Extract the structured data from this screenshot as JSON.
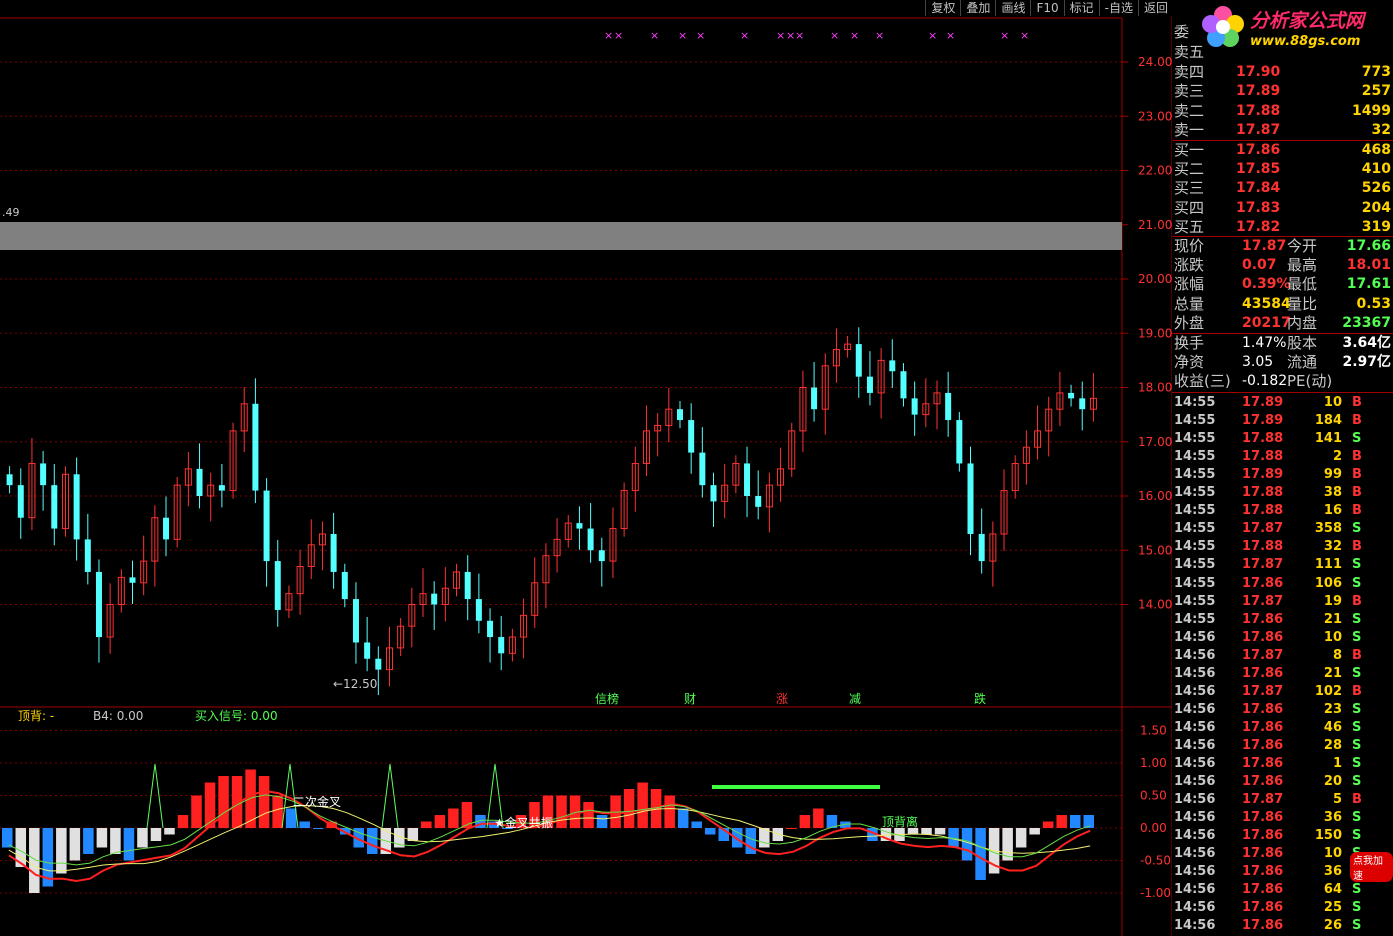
{
  "toolbar": [
    "复权",
    "叠加",
    "画线",
    "F10",
    "标记",
    "-自选",
    "返回"
  ],
  "logo": {
    "brand": "分析家公式网",
    "url": "www.88gs.com"
  },
  "colors": {
    "up": "#ff3232",
    "down": "#54ffff",
    "grid": "#7a0000",
    "axis": "#a00000",
    "label_red": "#ff3232",
    "label_yellow": "#ffd400",
    "label_green": "#52ff52",
    "magenta": "#ff40ff"
  },
  "price_axis": {
    "ticks": [
      "24.00",
      "23.00",
      "22.00",
      "21.00",
      "20.00",
      "19.00",
      "18.00",
      "17.00",
      "16.00",
      "15.00",
      "14.00"
    ],
    "min": 12.6,
    "max": 24.0
  },
  "price_chart": {
    "left_level_label": "49",
    "min_marker": "←12.50",
    "bottom_tags": [
      {
        "text": "信榜",
        "color": "#52ff52",
        "x": 607
      },
      {
        "text": "财",
        "color": "#52ff52",
        "x": 690
      },
      {
        "text": "涨",
        "color": "#ff3232",
        "x": 782
      },
      {
        "text": "减",
        "color": "#52ff52",
        "x": 855
      },
      {
        "text": "跌",
        "color": "#52ff52",
        "x": 980
      }
    ],
    "top_marker": "×"
  },
  "indicator": {
    "legend": [
      {
        "text": "顶背: -",
        "color": "#ffd400"
      },
      {
        "text": "B4: 0.00",
        "color": "#c8c8c8"
      },
      {
        "text": "买入信号: 0.00",
        "color": "#52ff52"
      }
    ],
    "axis_ticks": [
      "1.50",
      "1.00",
      "0.50",
      "0.00",
      "-0.50",
      "-1.00"
    ],
    "annotations": [
      {
        "text": "二次金叉",
        "color": "#ffffff"
      },
      {
        "text": "★金叉共振",
        "color": "#ffffff"
      },
      {
        "text": "顶背离",
        "color": "#52ff52"
      }
    ]
  },
  "chart_data": {
    "type": "candlestick",
    "price": {
      "ylim": [
        12.6,
        24.0
      ],
      "approx_closes": [
        16.2,
        15.6,
        16.6,
        16.2,
        15.4,
        16.4,
        15.2,
        14.6,
        13.4,
        14.0,
        14.5,
        14.4,
        14.8,
        15.6,
        15.2,
        16.2,
        16.5,
        16.0,
        16.2,
        16.1,
        17.2,
        17.7,
        16.1,
        14.8,
        13.9,
        14.2,
        14.7,
        15.1,
        15.3,
        14.6,
        14.1,
        13.3,
        13.0,
        12.8,
        13.2,
        13.6,
        14.0,
        14.2,
        14.0,
        14.3,
        14.6,
        14.1,
        13.7,
        13.4,
        13.1,
        13.4,
        13.8,
        14.4,
        14.9,
        15.2,
        15.5,
        15.4,
        15.0,
        14.8,
        15.4,
        16.1,
        16.6,
        17.2,
        17.3,
        17.6,
        17.4,
        16.8,
        16.2,
        15.9,
        16.2,
        16.6,
        16.0,
        15.8,
        16.2,
        16.5,
        17.2,
        18.0,
        17.6,
        18.4,
        18.7,
        18.8,
        18.2,
        17.9,
        18.5,
        18.3,
        17.8,
        17.5,
        17.7,
        17.9,
        17.4,
        16.6,
        15.3,
        14.8,
        15.3,
        16.1,
        16.6,
        16.9,
        17.2,
        17.6,
        17.9,
        17.8,
        17.6,
        17.8
      ]
    },
    "indicator": {
      "ylim": [
        -1.2,
        1.7
      ],
      "hist_approx": [
        -0.3,
        -0.6,
        -1.0,
        -0.9,
        -0.7,
        -0.5,
        -0.4,
        -0.3,
        -0.4,
        -0.5,
        -0.3,
        -0.2,
        -0.1,
        0.2,
        0.5,
        0.7,
        0.8,
        0.8,
        0.9,
        0.8,
        0.5,
        0.3,
        0.1,
        0.0,
        0.1,
        -0.1,
        -0.3,
        -0.4,
        -0.4,
        -0.3,
        -0.2,
        0.1,
        0.2,
        0.3,
        0.4,
        0.2,
        0.1,
        0.0,
        0.2,
        0.4,
        0.5,
        0.5,
        0.5,
        0.4,
        0.2,
        0.5,
        0.6,
        0.7,
        0.6,
        0.5,
        0.3,
        0.1,
        -0.1,
        -0.2,
        -0.3,
        -0.4,
        -0.3,
        -0.2,
        0.0,
        0.2,
        0.3,
        0.2,
        0.1,
        0.0,
        -0.2,
        -0.2,
        -0.2,
        -0.1,
        -0.1,
        -0.1,
        -0.3,
        -0.5,
        -0.8,
        -0.7,
        -0.5,
        -0.3,
        -0.1,
        0.1,
        0.2,
        0.2,
        0.2
      ]
    }
  },
  "quote": {
    "header_label": "委",
    "asks": [
      {
        "label": "卖五",
        "price": "",
        "vol": ""
      },
      {
        "label": "卖四",
        "price": "17.90",
        "vol": "773"
      },
      {
        "label": "卖三",
        "price": "17.89",
        "vol": "257"
      },
      {
        "label": "卖二",
        "price": "17.88",
        "vol": "1499"
      },
      {
        "label": "卖一",
        "price": "17.87",
        "vol": "32"
      }
    ],
    "bids": [
      {
        "label": "买一",
        "price": "17.86",
        "vol": "468"
      },
      {
        "label": "买二",
        "price": "17.85",
        "vol": "410"
      },
      {
        "label": "买三",
        "price": "17.84",
        "vol": "526"
      },
      {
        "label": "买四",
        "price": "17.83",
        "vol": "204"
      },
      {
        "label": "买五",
        "price": "17.82",
        "vol": "319"
      }
    ],
    "stats": [
      {
        "l1": "现价",
        "v1": "17.87",
        "c1": "#ff3232",
        "l2": "今开",
        "v2": "17.66",
        "c2": "#52ff52"
      },
      {
        "l1": "涨跌",
        "v1": "0.07",
        "c1": "#ff3232",
        "l2": "最高",
        "v2": "18.01",
        "c2": "#ff3232"
      },
      {
        "l1": "涨幅",
        "v1": "0.39%",
        "c1": "#ff3232",
        "l2": "最低",
        "v2": "17.61",
        "c2": "#52ff52"
      },
      {
        "l1": "总量",
        "v1": "43584",
        "c1": "#ffd400",
        "l2": "量比",
        "v2": "0.53",
        "c2": "#ffd400"
      },
      {
        "l1": "外盘",
        "v1": "20217",
        "c1": "#ff3232",
        "l2": "内盘",
        "v2": "23367",
        "c2": "#52ff52"
      }
    ],
    "fin": [
      {
        "l1": "换手",
        "v1": "1.47%",
        "l2": "股本",
        "v2": "3.64亿"
      },
      {
        "l1": "净资",
        "v1": "3.05",
        "l2": "流通",
        "v2": "2.97亿"
      },
      {
        "l1": "收益(三)",
        "v1": "-0.182",
        "l2": "PE(动)",
        "v2": ""
      }
    ]
  },
  "trades": [
    {
      "t": "14:55",
      "p": "17.89",
      "q": "10",
      "d": "B"
    },
    {
      "t": "14:55",
      "p": "17.89",
      "q": "184",
      "d": "B"
    },
    {
      "t": "14:55",
      "p": "17.88",
      "q": "141",
      "d": "S"
    },
    {
      "t": "14:55",
      "p": "17.88",
      "q": "2",
      "d": "B"
    },
    {
      "t": "14:55",
      "p": "17.89",
      "q": "99",
      "d": "B"
    },
    {
      "t": "14:55",
      "p": "17.88",
      "q": "38",
      "d": "B"
    },
    {
      "t": "14:55",
      "p": "17.88",
      "q": "16",
      "d": "B"
    },
    {
      "t": "14:55",
      "p": "17.87",
      "q": "358",
      "d": "S"
    },
    {
      "t": "14:55",
      "p": "17.88",
      "q": "32",
      "d": "B"
    },
    {
      "t": "14:55",
      "p": "17.87",
      "q": "111",
      "d": "S"
    },
    {
      "t": "14:55",
      "p": "17.86",
      "q": "106",
      "d": "S"
    },
    {
      "t": "14:55",
      "p": "17.87",
      "q": "19",
      "d": "B"
    },
    {
      "t": "14:55",
      "p": "17.86",
      "q": "21",
      "d": "S"
    },
    {
      "t": "14:56",
      "p": "17.86",
      "q": "10",
      "d": "S"
    },
    {
      "t": "14:56",
      "p": "17.87",
      "q": "8",
      "d": "B"
    },
    {
      "t": "14:56",
      "p": "17.86",
      "q": "21",
      "d": "S"
    },
    {
      "t": "14:56",
      "p": "17.87",
      "q": "102",
      "d": "B"
    },
    {
      "t": "14:56",
      "p": "17.86",
      "q": "23",
      "d": "S"
    },
    {
      "t": "14:56",
      "p": "17.86",
      "q": "46",
      "d": "S"
    },
    {
      "t": "14:56",
      "p": "17.86",
      "q": "28",
      "d": "S"
    },
    {
      "t": "14:56",
      "p": "17.86",
      "q": "1",
      "d": "S"
    },
    {
      "t": "14:56",
      "p": "17.86",
      "q": "20",
      "d": "S"
    },
    {
      "t": "14:56",
      "p": "17.87",
      "q": "5",
      "d": "B"
    },
    {
      "t": "14:56",
      "p": "17.86",
      "q": "36",
      "d": "S"
    },
    {
      "t": "14:56",
      "p": "17.86",
      "q": "150",
      "d": "S"
    },
    {
      "t": "14:56",
      "p": "17.86",
      "q": "10",
      "d": "S"
    },
    {
      "t": "14:56",
      "p": "17.86",
      "q": "36",
      "d": "S"
    },
    {
      "t": "14:56",
      "p": "17.86",
      "q": "64",
      "d": "S"
    },
    {
      "t": "14:56",
      "p": "17.86",
      "q": "25",
      "d": "S"
    },
    {
      "t": "14:56",
      "p": "17.86",
      "q": "26",
      "d": "S"
    }
  ],
  "ad_button": "点我加速"
}
